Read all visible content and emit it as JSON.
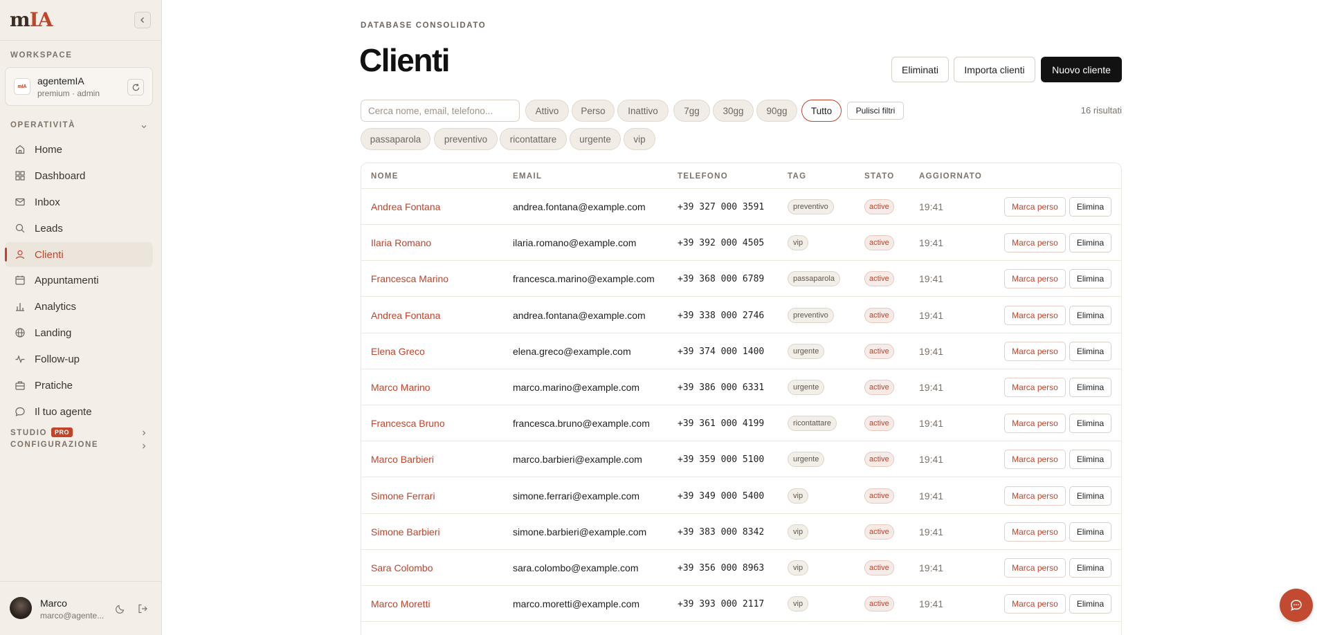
{
  "app": {
    "logo_text_m": "m",
    "logo_text_ia": "IA"
  },
  "sidebar": {
    "workspace_label": "WORKSPACE",
    "workspace": {
      "avatar": "mIA",
      "name": "agentemIA",
      "sub": "premium · admin"
    },
    "operativita_label": "OPERATIVITÀ",
    "items": [
      {
        "label": "Home",
        "icon": "home-icon"
      },
      {
        "label": "Dashboard",
        "icon": "dashboard-icon"
      },
      {
        "label": "Inbox",
        "icon": "mail-icon"
      },
      {
        "label": "Leads",
        "icon": "search-icon"
      },
      {
        "label": "Clienti",
        "icon": "user-icon",
        "active": true
      },
      {
        "label": "Appuntamenti",
        "icon": "calendar-icon"
      },
      {
        "label": "Analytics",
        "icon": "bar-chart-icon"
      },
      {
        "label": "Landing",
        "icon": "globe-icon"
      },
      {
        "label": "Follow-up",
        "icon": "activity-icon"
      },
      {
        "label": "Pratiche",
        "icon": "briefcase-icon"
      },
      {
        "label": "Il tuo agente",
        "icon": "chat-icon"
      }
    ],
    "studio_label": "STUDIO",
    "pro_badge": "PRO",
    "config_label": "CONFIGURAZIONE",
    "user": {
      "name": "Marco",
      "email": "marco@agente..."
    }
  },
  "main": {
    "eyebrow": "DATABASE CONSOLIDATO",
    "title": "Clienti",
    "buttons": {
      "deleted": "Eliminati",
      "import": "Importa clienti",
      "new": "Nuovo cliente"
    },
    "search_placeholder": "Cerca nome, email, telefono...",
    "status_filters": [
      "Attivo",
      "Perso",
      "Inattivo"
    ],
    "period_filters": [
      "7gg",
      "30gg",
      "90gg",
      "Tutto"
    ],
    "selected_period": "Tutto",
    "clear_filters": "Pulisci filtri",
    "results_count": "16 risultati",
    "tag_filters": [
      "passaparola",
      "preventivo",
      "ricontattare",
      "urgente",
      "vip"
    ]
  },
  "table": {
    "headers": [
      "NOME",
      "EMAIL",
      "TELEFONO",
      "TAG",
      "STATO",
      "AGGIORNATO"
    ],
    "mark_lost_label": "Marca perso",
    "delete_label": "Elimina",
    "rows": [
      {
        "name": "Andrea Fontana",
        "email": "andrea.fontana@example.com",
        "phone": "+39 327 000 3591",
        "tag": "preventivo",
        "status": "active",
        "updated": "19:41"
      },
      {
        "name": "Ilaria Romano",
        "email": "ilaria.romano@example.com",
        "phone": "+39 392 000 4505",
        "tag": "vip",
        "status": "active",
        "updated": "19:41"
      },
      {
        "name": "Francesca Marino",
        "email": "francesca.marino@example.com",
        "phone": "+39 368 000 6789",
        "tag": "passaparola",
        "status": "active",
        "updated": "19:41"
      },
      {
        "name": "Andrea Fontana",
        "email": "andrea.fontana@example.com",
        "phone": "+39 338 000 2746",
        "tag": "preventivo",
        "status": "active",
        "updated": "19:41"
      },
      {
        "name": "Elena Greco",
        "email": "elena.greco@example.com",
        "phone": "+39 374 000 1400",
        "tag": "urgente",
        "status": "active",
        "updated": "19:41"
      },
      {
        "name": "Marco Marino",
        "email": "marco.marino@example.com",
        "phone": "+39 386 000 6331",
        "tag": "urgente",
        "status": "active",
        "updated": "19:41"
      },
      {
        "name": "Francesca Bruno",
        "email": "francesca.bruno@example.com",
        "phone": "+39 361 000 4199",
        "tag": "ricontattare",
        "status": "active",
        "updated": "19:41"
      },
      {
        "name": "Marco Barbieri",
        "email": "marco.barbieri@example.com",
        "phone": "+39 359 000 5100",
        "tag": "urgente",
        "status": "active",
        "updated": "19:41"
      },
      {
        "name": "Simone Ferrari",
        "email": "simone.ferrari@example.com",
        "phone": "+39 349 000 5400",
        "tag": "vip",
        "status": "active",
        "updated": "19:41"
      },
      {
        "name": "Simone Barbieri",
        "email": "simone.barbieri@example.com",
        "phone": "+39 383 000 8342",
        "tag": "vip",
        "status": "active",
        "updated": "19:41"
      },
      {
        "name": "Sara Colombo",
        "email": "sara.colombo@example.com",
        "phone": "+39 356 000 8963",
        "tag": "vip",
        "status": "active",
        "updated": "19:41"
      },
      {
        "name": "Marco Moretti",
        "email": "marco.moretti@example.com",
        "phone": "+39 393 000 2117",
        "tag": "vip",
        "status": "active",
        "updated": "19:41"
      }
    ]
  },
  "colors": {
    "accent": "#c0432a",
    "sidebar_bg": "#f3efe8",
    "dark_button": "#121212"
  }
}
